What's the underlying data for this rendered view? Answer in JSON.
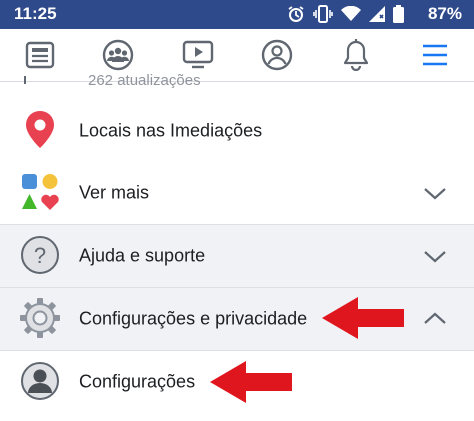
{
  "status_bar": {
    "time": "11:25",
    "battery": "87%",
    "icons": [
      "alarm-icon",
      "vibrate-icon",
      "wifi-icon",
      "signal-icon",
      "battery-icon"
    ]
  },
  "nav": {
    "tabs": [
      "news-feed-icon",
      "groups-icon",
      "watch-icon",
      "profile-icon",
      "notifications-icon",
      "menu-icon"
    ],
    "active": "menu-icon"
  },
  "menu": {
    "peek_text": "262 atualizações",
    "items": [
      {
        "label": "Locais nas Imediações",
        "icon": "location-pin-icon"
      },
      {
        "label": "Ver mais",
        "icon": "shapes-icon",
        "chevron": "down"
      },
      {
        "label": "Ajuda e suporte",
        "icon": "help-icon",
        "chevron": "down"
      },
      {
        "label": "Configurações e privacidade",
        "icon": "gear-icon",
        "chevron": "up"
      },
      {
        "label": "Configurações",
        "icon": "person-icon"
      }
    ]
  },
  "colors": {
    "status_bar_bg": "#2f4a8a",
    "active_tab": "#1877f2",
    "annotation_arrow": "#e0161e",
    "pin": "#e8414f"
  }
}
